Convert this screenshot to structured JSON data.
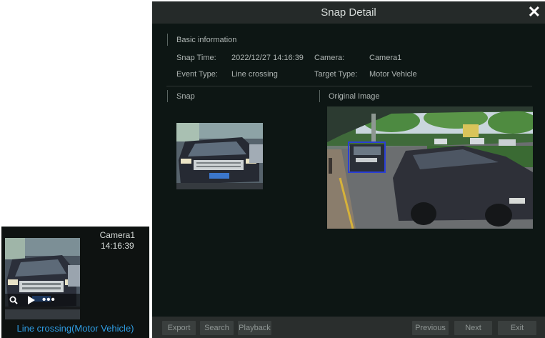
{
  "thumbnail": {
    "camera": "Camera1",
    "time": "14:16:39",
    "caption": "Line crossing(Motor Vehicle)",
    "tools": [
      "search-icon",
      "play-icon",
      "more-icon"
    ]
  },
  "dialog": {
    "title": "Snap Detail",
    "close_label": "✕",
    "basic": {
      "heading": "Basic information",
      "snap_time_label": "Snap Time:",
      "snap_time_value": "2022/12/27 14:16:39",
      "camera_label": "Camera:",
      "camera_value": "Camera1",
      "event_type_label": "Event Type:",
      "event_type_value": "Line crossing",
      "target_type_label": "Target Type:",
      "target_type_value": "Motor Vehicle"
    },
    "snap_heading": "Snap",
    "original_heading": "Original Image",
    "buttons": {
      "export": "Export",
      "search": "Search",
      "playback": "Playback",
      "previous": "Previous",
      "next": "Next",
      "exit": "Exit"
    }
  },
  "colors": {
    "dialog_bg": "#0d1614",
    "titlebar_bg": "#252a29",
    "caption_blue": "#2f9de3",
    "detection_box": "#2b3fd6"
  }
}
